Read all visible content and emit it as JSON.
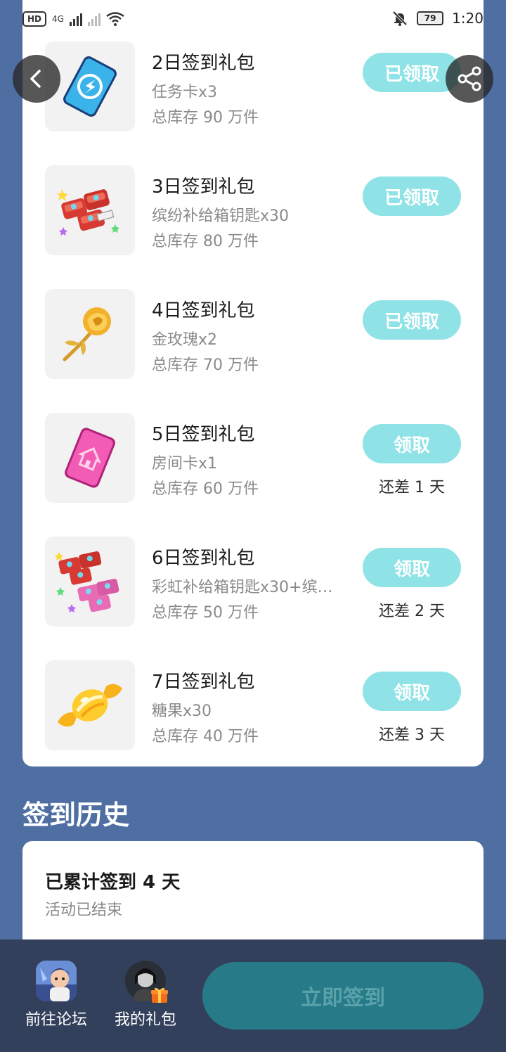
{
  "status_bar": {
    "hd": "HD",
    "sim": "1",
    "network": "4G",
    "battery": "79",
    "time": "1:20"
  },
  "gifts": [
    {
      "title": "2日签到礼包",
      "desc": "任务卡x3",
      "stock": "总库存 90 万件",
      "button": "已领取",
      "note": "",
      "icon": "task-card-icon"
    },
    {
      "title": "3日签到礼包",
      "desc": "缤纷补给箱钥匙x30",
      "stock": "总库存 80 万件",
      "button": "已领取",
      "note": "",
      "icon": "supply-key-icon"
    },
    {
      "title": "4日签到礼包",
      "desc": "金玫瑰x2",
      "stock": "总库存 70 万件",
      "button": "已领取",
      "note": "",
      "icon": "gold-rose-icon"
    },
    {
      "title": "5日签到礼包",
      "desc": "房间卡x1",
      "stock": "总库存 60 万件",
      "button": "领取",
      "note": "还差 1 天",
      "icon": "room-card-icon"
    },
    {
      "title": "6日签到礼包",
      "desc": "彩虹补给箱钥匙x30+缤…",
      "stock": "总库存 50 万件",
      "button": "领取",
      "note": "还差 2 天",
      "icon": "rainbow-key-icon"
    },
    {
      "title": "7日签到礼包",
      "desc": "糖果x30",
      "stock": "总库存 40 万件",
      "button": "领取",
      "note": "还差 3 天",
      "icon": "candy-icon"
    }
  ],
  "history": {
    "title": "签到历史",
    "count": "已累计签到 4 天",
    "status": "活动已结束"
  },
  "bottom_bar": {
    "forum_label": "前往论坛",
    "gifts_label": "我的礼包",
    "checkin_label": "立即签到"
  },
  "colors": {
    "page_bg": "#4f6fa3",
    "button_teal": "#8fe3e6",
    "bottom_bar": "#33405c",
    "checkin_btn": "#277b89"
  }
}
